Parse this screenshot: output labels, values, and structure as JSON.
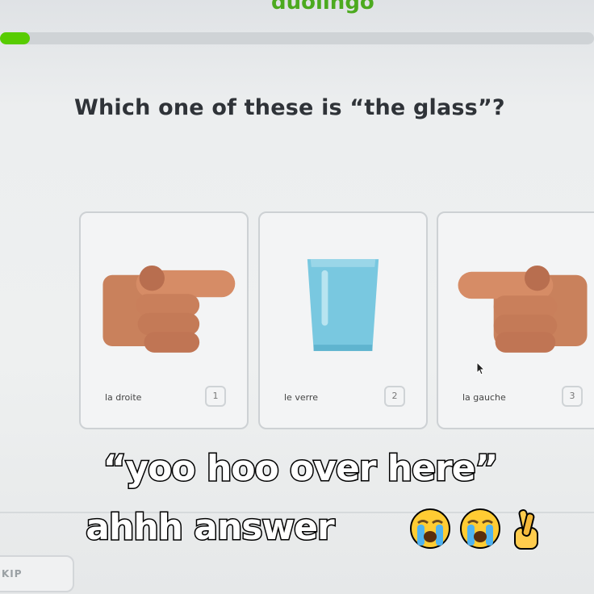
{
  "app": {
    "brand": "duolingo"
  },
  "progress": {
    "fraction": 0.05,
    "color": "#58cc02"
  },
  "question": "Which one of these is “the glass”?",
  "choices": [
    {
      "label": "la droite",
      "key": "1",
      "icon": "hand-pointing-right-icon"
    },
    {
      "label": "le verre",
      "key": "2",
      "icon": "glass-icon"
    },
    {
      "label": "la gauche",
      "key": "3",
      "icon": "hand-pointing-left-icon"
    }
  ],
  "footer": {
    "skip_label": "KIP"
  },
  "caption": {
    "line1": "“yoo hoo over here”",
    "line2": "ahhh answer",
    "emojis": [
      "loudly-crying-face-icon",
      "loudly-crying-face-icon",
      "crossed-fingers-icon"
    ]
  }
}
